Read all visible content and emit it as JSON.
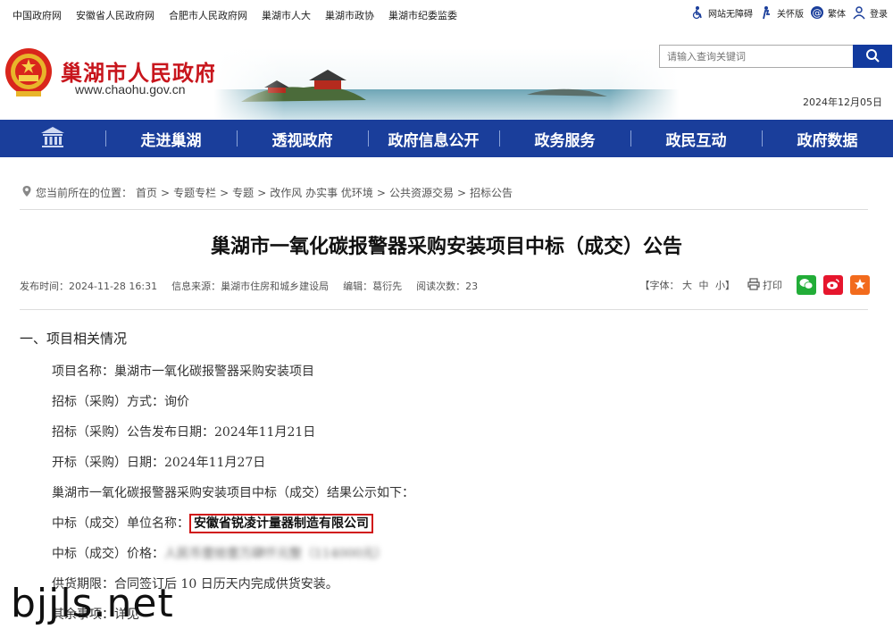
{
  "top_links": [
    "中国政府网",
    "安徽省人民政府网",
    "合肥市人民政府网",
    "巢湖市人大",
    "巢湖市政协",
    "巢湖市纪委监委"
  ],
  "tools": {
    "accessible": "网站无障碍",
    "care": "关怀版",
    "traditional": "繁体",
    "login": "登录"
  },
  "header": {
    "site_name": "巢湖市人民政府",
    "site_url": "www.chaohu.gov.cn",
    "date": "2024年12月05日"
  },
  "search": {
    "placeholder": "请输入查询关键词"
  },
  "nav": [
    "走进巢湖",
    "透视政府",
    "政府信息公开",
    "政务服务",
    "政民互动",
    "政府数据"
  ],
  "breadcrumb": {
    "prefix": "您当前所在的位置：",
    "items": [
      "首页",
      "专题专栏",
      "专题",
      "改作风 办实事 优环境",
      "公共资源交易",
      "招标公告"
    ]
  },
  "article": {
    "title": "巢湖市一氧化碳报警器采购安装项目中标（成交）公告",
    "publish_time": "发布时间：2024-11-28 16:31",
    "source": "信息来源：巢湖市住房和城乡建设局",
    "editor": "编辑：葛衍先",
    "views": "阅读次数：23",
    "font_label": "【字体：",
    "font_large": "大",
    "font_medium": "中",
    "font_small": "小】",
    "print": "打印"
  },
  "content": {
    "section": "一、项目相关情况",
    "lines": {
      "project_name": "项目名称：巢湖市一氧化碳报警器采购安装项目",
      "method": "招标（采购）方式：询价",
      "announce_date": "招标（采购）公告发布日期：2024年11月21日",
      "open_date": "开标（采购）日期：2024年11月27日",
      "result_intro": "巢湖市一氧化碳报警器采购安装项目中标（成交）结果公示如下：",
      "winner_label": "中标（成交）单位名称：",
      "winner": "安徽省锐凌计量器制造有限公司",
      "price_label": "中标（成交）价格：",
      "price": "人民币壹拾壹万肆仟元整（114000元）",
      "period": "供货期限：合同签订后 10 日历天内完成供货安装。",
      "other": "其余事项：详见"
    }
  },
  "watermark": "bjjls.net",
  "colors": {
    "nav": "#1a3e9b",
    "brand_red": "#c8161d",
    "highlight": "#d01515"
  }
}
